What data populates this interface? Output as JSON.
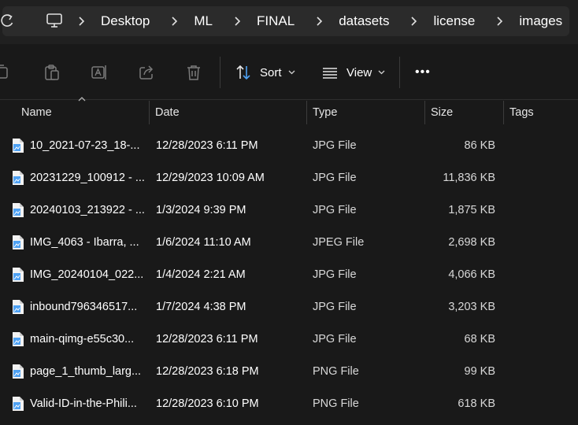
{
  "breadcrumb": [
    "Desktop",
    "ML",
    "FINAL",
    "datasets",
    "license",
    "images"
  ],
  "toolbar": {
    "sort_label": "Sort",
    "view_label": "View",
    "more_label": "•••"
  },
  "columns": {
    "name": "Name",
    "date": "Date",
    "type": "Type",
    "size": "Size",
    "tags": "Tags"
  },
  "files": [
    {
      "name": "10_2021-07-23_18-...",
      "date": "12/28/2023 6:11 PM",
      "type": "JPG File",
      "size": "86 KB"
    },
    {
      "name": "20231229_100912 - ...",
      "date": "12/29/2023 10:09 AM",
      "type": "JPG File",
      "size": "11,836 KB"
    },
    {
      "name": "20240103_213922 - ...",
      "date": "1/3/2024 9:39 PM",
      "type": "JPG File",
      "size": "1,875 KB"
    },
    {
      "name": "IMG_4063 - Ibarra, ...",
      "date": "1/6/2024 11:10 AM",
      "type": "JPEG File",
      "size": "2,698 KB"
    },
    {
      "name": "IMG_20240104_022...",
      "date": "1/4/2024 2:21 AM",
      "type": "JPG File",
      "size": "4,066 KB"
    },
    {
      "name": "inbound796346517...",
      "date": "1/7/2024 4:38 PM",
      "type": "JPG File",
      "size": "3,203 KB"
    },
    {
      "name": "main-qimg-e55c30...",
      "date": "12/28/2023 6:11 PM",
      "type": "JPG File",
      "size": "68 KB"
    },
    {
      "name": "page_1_thumb_larg...",
      "date": "12/28/2023 6:18 PM",
      "type": "PNG File",
      "size": "99 KB"
    },
    {
      "name": "Valid-ID-in-the-Phili...",
      "date": "12/28/2023 6:10 PM",
      "type": "PNG File",
      "size": "618 KB"
    }
  ],
  "colors": {
    "background": "#191919",
    "address_bar": "#202020",
    "crumb_box": "#2b2b2b",
    "icon_accent": "#4ea1f3"
  }
}
